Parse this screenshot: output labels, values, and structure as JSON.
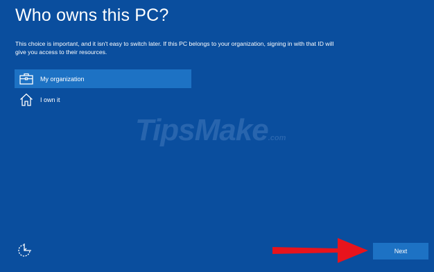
{
  "page": {
    "title": "Who owns this PC?",
    "description": "This choice is important, and it isn't easy to switch later. If this PC belongs to your organization, signing in with that ID will give you access to their resources."
  },
  "options": [
    {
      "label": "My organization",
      "icon": "briefcase-icon",
      "selected": true
    },
    {
      "label": "I own it",
      "icon": "home-icon",
      "selected": false
    }
  ],
  "watermark": {
    "text": "TipsMake",
    "suffix": ".com"
  },
  "footer": {
    "next_label": "Next",
    "ease_of_access_icon": "ease-of-access-icon"
  },
  "colors": {
    "background": "#0a4e9e",
    "selected": "#1d72c4",
    "button": "#1d72c4",
    "arrow": "#e8141c"
  }
}
